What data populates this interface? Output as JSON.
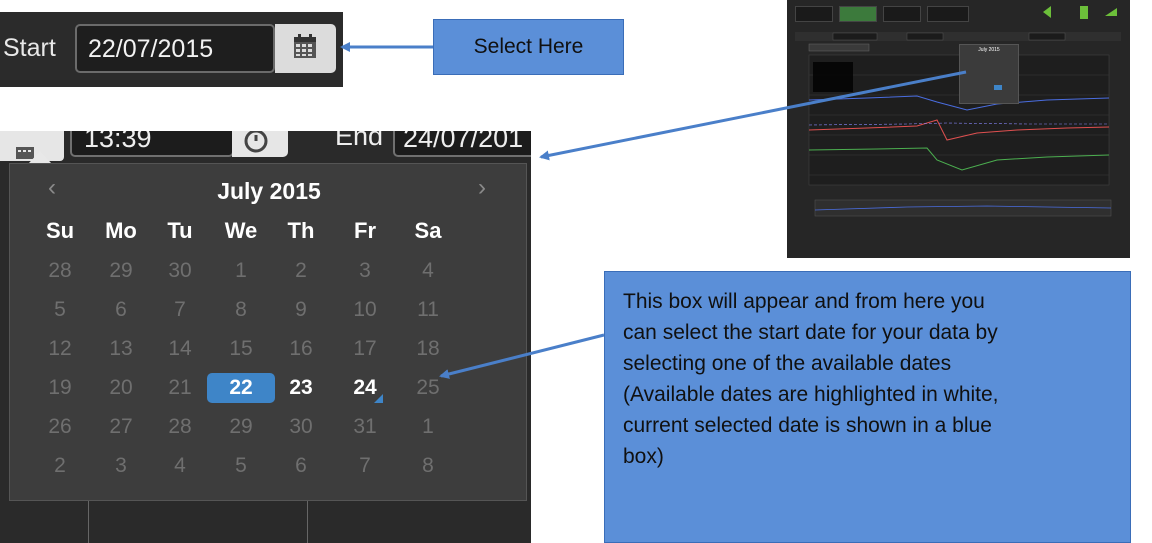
{
  "start_field": {
    "label": "Start",
    "value": "22/07/2015",
    "calendar_icon": "calendar-icon"
  },
  "callout_select": "Select Here",
  "picker_header": {
    "time_value": "13:39",
    "clock_icon": "clock-icon",
    "end_label": "End",
    "end_value": "24/07/201"
  },
  "calendar": {
    "month_label": "July 2015",
    "prev_glyph": "‹",
    "next_glyph": "›",
    "weekdays": [
      "Su",
      "Mo",
      "Tu",
      "We",
      "Th",
      "Fr",
      "Sa"
    ],
    "weeks": [
      [
        "28",
        "29",
        "30",
        "1",
        "2",
        "3",
        "4"
      ],
      [
        "5",
        "6",
        "7",
        "8",
        "9",
        "10",
        "11"
      ],
      [
        "12",
        "13",
        "14",
        "15",
        "16",
        "17",
        "18"
      ],
      [
        "19",
        "20",
        "21",
        "22",
        "23",
        "24",
        "25"
      ],
      [
        "26",
        "27",
        "28",
        "29",
        "30",
        "31",
        "1"
      ],
      [
        "2",
        "3",
        "4",
        "5",
        "6",
        "7",
        "8"
      ]
    ],
    "available_days": [
      "22",
      "23",
      "24"
    ],
    "selected_day": "22",
    "selected_color": "#3e85c8"
  },
  "callout_info": [
    "This box will appear and from here you",
    "can select the start date for your data by",
    "selecting one of the available dates",
    "(Available dates are highlighted in white,",
    "current selected date is shown in a blue",
    "box)"
  ],
  "colors": {
    "callout_blue": "#5b8fd8",
    "arrow_blue": "#4a7fc9",
    "dark_bg": "#2a2a2a"
  }
}
